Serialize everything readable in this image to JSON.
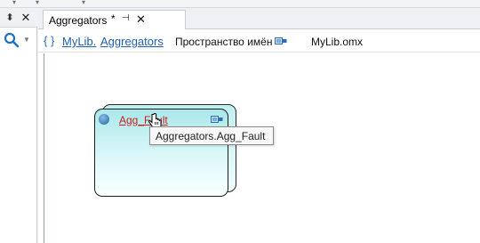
{
  "left_panel": {
    "pin_glyph": "⬍",
    "close_glyph": "✕"
  },
  "document_tab": {
    "title": "Aggregators",
    "modified_marker": "*",
    "pin_glyph": "⊣",
    "close_glyph": "✕"
  },
  "breadcrumb": {
    "braces": "{ }",
    "root_link": "MyLib.",
    "leaf_link": "Aggregators",
    "kind_label": "Пространство имён",
    "file_name": "MyLib.omx"
  },
  "component": {
    "name": "Agg_Fault",
    "tooltip": "Aggregators.Agg_Fault"
  },
  "colors": {
    "link_blue": "#1f5fb4",
    "component_name_red": "#d21d1d",
    "block_fill_top": "#a9e8ea",
    "block_fill_bottom": "#f8feff"
  }
}
